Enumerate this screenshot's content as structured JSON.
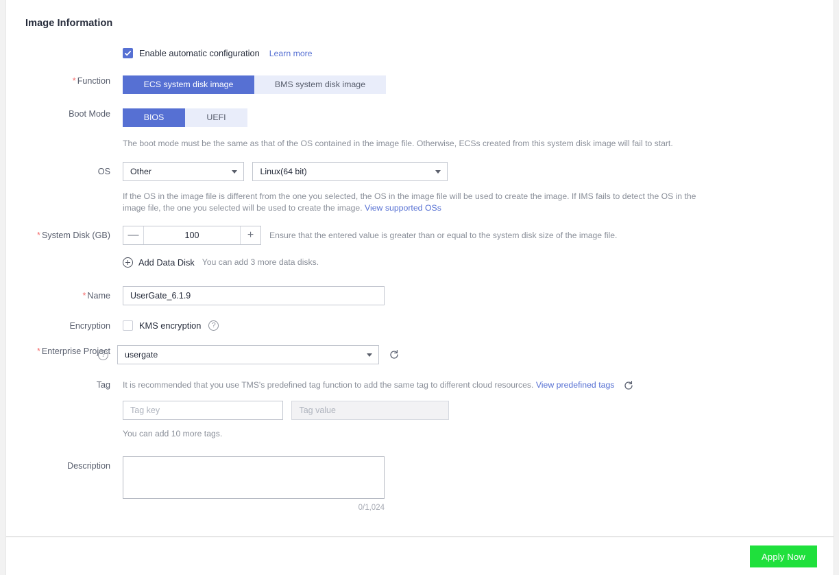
{
  "page": {
    "section_title": "Image Information",
    "accent_color": "#5670d3",
    "required_color": "#f56c6c",
    "apply_button_color": "#1fe03c"
  },
  "auto_config": {
    "checked": true,
    "label": "Enable automatic configuration",
    "learn_more": "Learn more"
  },
  "function": {
    "label": "Function",
    "required": true,
    "options": [
      "ECS system disk image",
      "BMS system disk image"
    ],
    "selected": "ECS system disk image"
  },
  "boot_mode": {
    "label": "Boot Mode",
    "required": false,
    "options": [
      "BIOS",
      "UEFI"
    ],
    "selected": "BIOS",
    "hint": "The boot mode must be the same as that of the OS contained in the image file. Otherwise, ECSs created from this system disk image will fail to start."
  },
  "os": {
    "label": "OS",
    "family_value": "Other",
    "version_value": "Linux(64 bit)",
    "hint": "If the OS in the image file is different from the one you selected, the OS in the image file will be used to create the image. If IMS fails to detect the OS in the image file, the one you selected will be used to create the image.",
    "hint_link": "View supported OSs"
  },
  "system_disk": {
    "label": "System Disk (GB)",
    "required": true,
    "value": "100",
    "minus": "—",
    "plus": "+",
    "hint": "Ensure that the entered value is greater than or equal to the system disk size of the image file."
  },
  "data_disk": {
    "add_label": "Add Data Disk",
    "hint": "You can add 3 more data disks."
  },
  "name": {
    "label": "Name",
    "required": true,
    "value": "UserGate_6.1.9"
  },
  "encryption": {
    "label": "Encryption",
    "checked": false,
    "checkbox_label": "KMS encryption",
    "help_icon": "question-mark-icon"
  },
  "enterprise_project": {
    "label": "Enterprise Project",
    "required": true,
    "value": "usergate",
    "help_icon": "question-mark-icon",
    "refresh_icon": "refresh-icon"
  },
  "tag": {
    "label": "Tag",
    "hint": "It is recommended that you use TMS's predefined tag function to add the same tag to different cloud resources.",
    "hint_link": "View predefined tags",
    "refresh_icon": "refresh-icon",
    "key_placeholder": "Tag key",
    "value_placeholder": "Tag value",
    "key_value": "",
    "value_value": "",
    "remaining": "You can add 10 more tags."
  },
  "description": {
    "label": "Description",
    "value": "",
    "counter": "0/1,024"
  },
  "footer": {
    "apply_label": "Apply Now"
  }
}
